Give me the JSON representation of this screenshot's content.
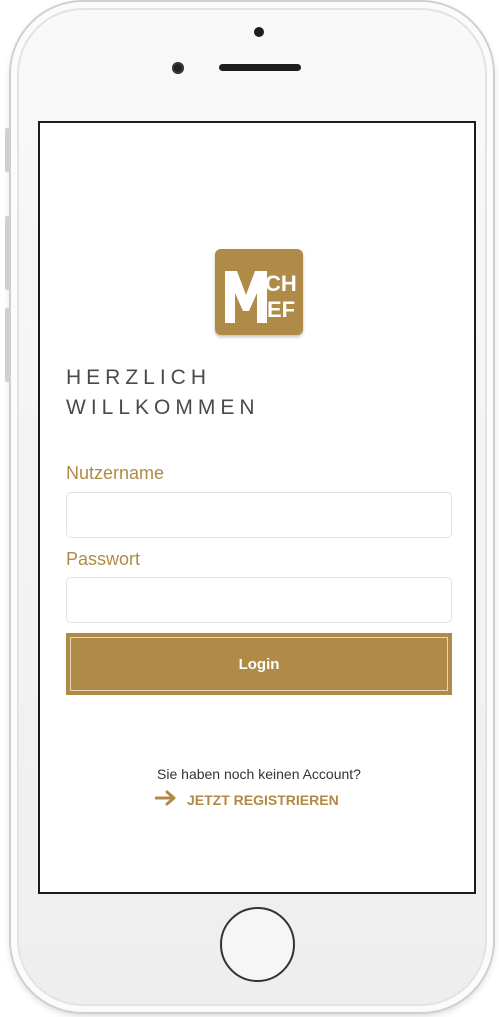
{
  "welcome": {
    "line1": "HERZLICH",
    "line2": "WILLKOMMEN"
  },
  "logo": {
    "text": "MCHEF",
    "icon": "mchef-logo"
  },
  "form": {
    "username_label": "Nutzername",
    "username_value": "",
    "password_label": "Passwort",
    "password_value": "",
    "login_label": "Login"
  },
  "footer": {
    "prompt": "Sie haben noch keinen Account?",
    "register_label": "JETZT REGISTRIEREN",
    "register_icon": "arrow-right-icon"
  },
  "colors": {
    "accent": "#b08a47",
    "text": "#4a4a4a"
  }
}
